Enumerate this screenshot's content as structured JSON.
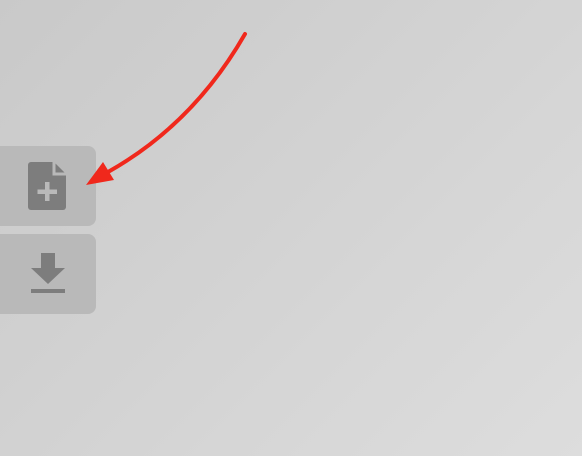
{
  "theme": {
    "button_bg": "#b9b9b9",
    "icon_color": "#7d7d7d",
    "arrow_color": "#f0281c"
  },
  "toolbar": {
    "buttons": [
      {
        "name": "new-file-button",
        "icon": "file-plus-icon"
      },
      {
        "name": "download-button",
        "icon": "download-icon"
      }
    ]
  }
}
